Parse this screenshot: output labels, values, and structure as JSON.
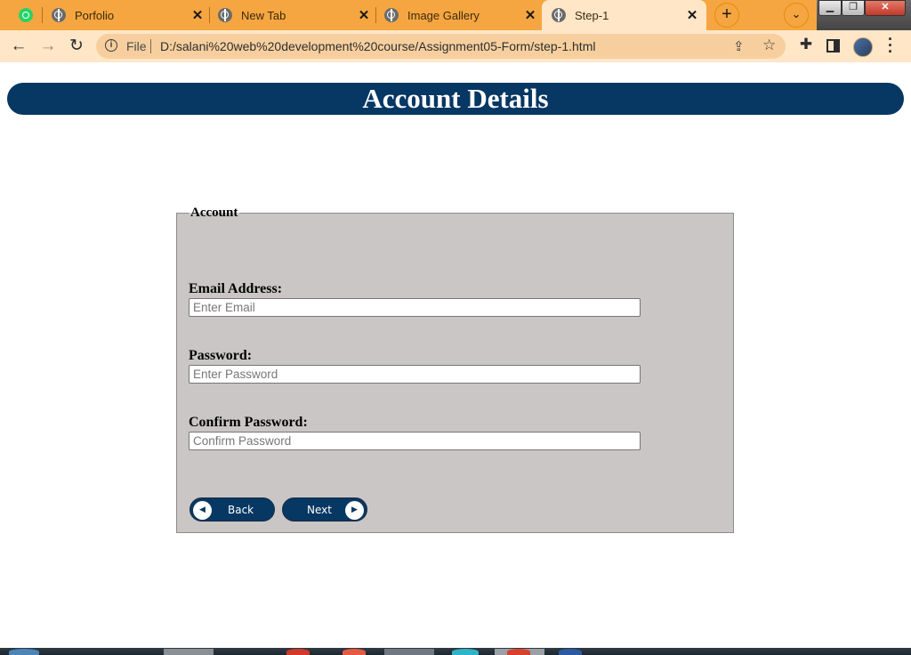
{
  "browser": {
    "tabs": [
      {
        "title": "",
        "icon": "whatsapp-icon"
      },
      {
        "title": "Porfolio",
        "icon": "globe-icon"
      },
      {
        "title": "New Tab",
        "icon": "chrome-icon"
      },
      {
        "title": "Image Gallery",
        "icon": "globe-icon"
      },
      {
        "title": "Step-1",
        "icon": "globe-icon",
        "active": true
      }
    ],
    "scheme_label": "File",
    "url": "D:/salani%20web%20development%20course/Assignment05-Form/step-1.html",
    "accent_color": "#f5a640"
  },
  "page": {
    "banner_title": "Account Details",
    "banner_color": "#073763",
    "fieldset_legend": "Account",
    "fields": [
      {
        "label": "Email Address:",
        "placeholder": "Enter Email"
      },
      {
        "label": "Password:",
        "placeholder": "Enter Password"
      },
      {
        "label": "Confirm Password:",
        "placeholder": "Confirm Password"
      }
    ],
    "back_label": "Back",
    "next_label": "Next"
  }
}
